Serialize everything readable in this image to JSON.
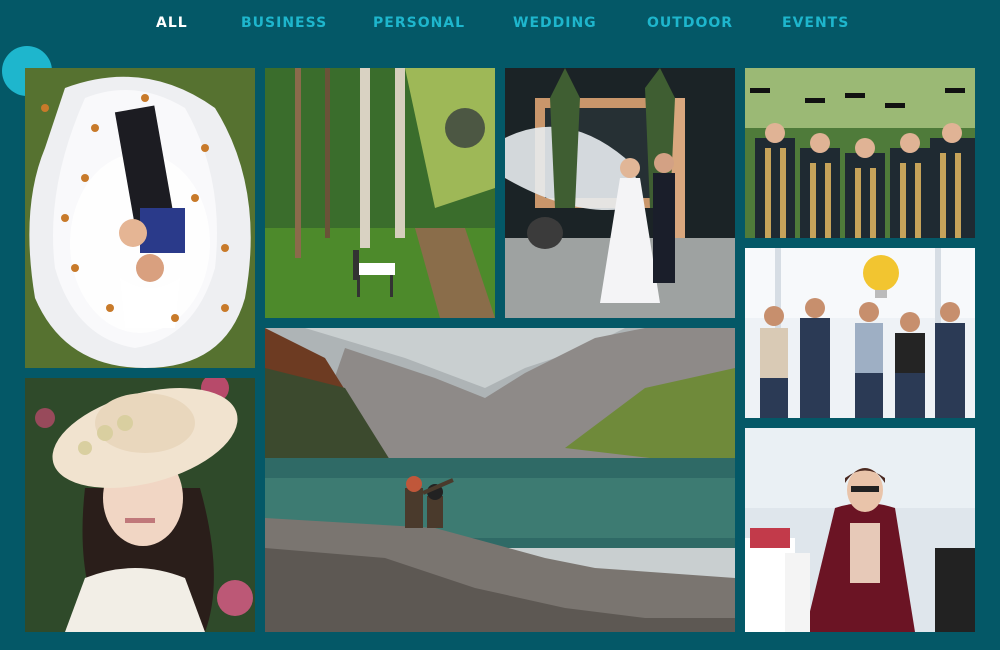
{
  "filters": [
    {
      "label": "ALL",
      "active": true
    },
    {
      "label": "BUSINESS",
      "active": false
    },
    {
      "label": "PERSONAL",
      "active": false
    },
    {
      "label": "WEDDING",
      "active": false
    },
    {
      "label": "OUTDOOR",
      "active": false
    },
    {
      "label": "EVENTS",
      "active": false
    }
  ],
  "colors": {
    "background": "#045867",
    "accent": "#1eb6cd",
    "active_filter": "#ffffff"
  },
  "gallery": [
    {
      "subject": "wedding couple lying in veil with autumn leaves",
      "category": "wedding"
    },
    {
      "subject": "park bench in green forest path",
      "category": "outdoor"
    },
    {
      "subject": "bride and groom with flying veil",
      "category": "wedding"
    },
    {
      "subject": "graduates tossing caps",
      "category": "events"
    },
    {
      "subject": "business team with lightbulb",
      "category": "business"
    },
    {
      "subject": "woman in sun hat portrait",
      "category": "personal"
    },
    {
      "subject": "couple sitting by mountain lake",
      "category": "outdoor"
    },
    {
      "subject": "woman with shopping bags",
      "category": "personal"
    }
  ]
}
